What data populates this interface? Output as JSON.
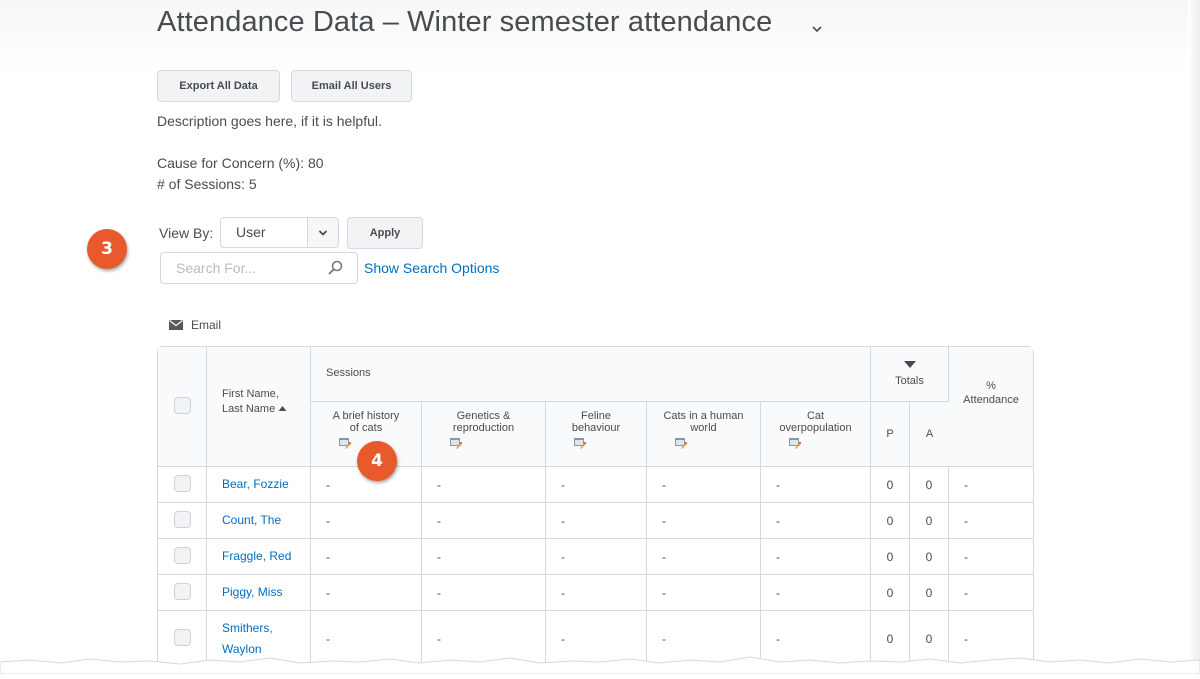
{
  "header": {
    "title": "Attendance Data – Winter semester attendance"
  },
  "toolbar": {
    "export_label": "Export All Data",
    "email_all_label": "Email All Users"
  },
  "info": {
    "description": "Description goes here, if it is helpful.",
    "cause_for_concern": "Cause for Concern (%): 80",
    "sessions_count": "# of Sessions: 5"
  },
  "filters": {
    "view_by_label": "View By:",
    "view_by_value": "User",
    "apply_label": "Apply",
    "search_placeholder": "Search For...",
    "search_value": "",
    "show_search_options": "Show Search Options"
  },
  "callouts": {
    "badge_3": "3",
    "badge_4": "4",
    "badge_color": "#e85a2c"
  },
  "actions": {
    "email_label": "Email"
  },
  "table": {
    "name_header_line1": "First Name,",
    "name_header_line2": "Last Name",
    "sessions_header": "Sessions",
    "totals_header": "Totals",
    "percent_header_line1": "%",
    "percent_header_line2": "Attendance",
    "present_header": "P",
    "absent_header": "A",
    "sessions": [
      {
        "line1": "A brief history",
        "line2": "of cats"
      },
      {
        "line1": "Genetics &",
        "line2": "reproduction"
      },
      {
        "line1": "Feline",
        "line2": "behaviour"
      },
      {
        "line1": "Cats in a human",
        "line2": "world"
      },
      {
        "line1": "Cat",
        "line2": "overpopulation"
      }
    ],
    "rows": [
      {
        "name": "Bear, Fozzie",
        "s": [
          "-",
          "-",
          "-",
          "-",
          "-"
        ],
        "p": "0",
        "a": "0",
        "pct": "-"
      },
      {
        "name": "Count, The",
        "s": [
          "-",
          "-",
          "-",
          "-",
          "-"
        ],
        "p": "0",
        "a": "0",
        "pct": "-"
      },
      {
        "name": "Fraggle, Red",
        "s": [
          "-",
          "-",
          "-",
          "-",
          "-"
        ],
        "p": "0",
        "a": "0",
        "pct": "-"
      },
      {
        "name": "Piggy, Miss",
        "s": [
          "-",
          "-",
          "-",
          "-",
          "-"
        ],
        "p": "0",
        "a": "0",
        "pct": "-"
      },
      {
        "name_line1": "Smithers,",
        "name_line2": "Waylon",
        "s": [
          "-",
          "-",
          "-",
          "-",
          "-"
        ],
        "p": "0",
        "a": "0",
        "pct": "-"
      }
    ]
  },
  "colors": {
    "link": "#006fbf",
    "text": "#494c4e",
    "border": "#d3d9e3"
  }
}
